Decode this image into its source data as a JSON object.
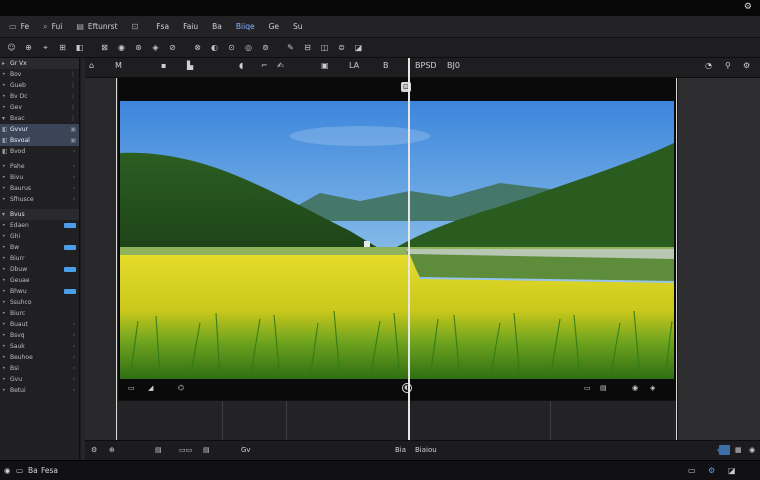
{
  "window": {
    "title_icon": "settings-icon",
    "title_glyph": "⚙"
  },
  "menubar": {
    "items": [
      {
        "icon": "▭",
        "label": "Fe"
      },
      {
        "icon": "⌕",
        "label": "Fui"
      },
      {
        "icon": "▤",
        "label": "Eftunrst"
      },
      {
        "icon": "⊡",
        "label": ""
      },
      {
        "icon": "",
        "label": "Fsa"
      },
      {
        "icon": "",
        "label": "Faiu"
      },
      {
        "icon": "",
        "label": "Ba"
      },
      {
        "icon": "",
        "label": "Biiqe"
      },
      {
        "icon": "",
        "label": "Ge"
      },
      {
        "icon": "",
        "label": "Su"
      }
    ]
  },
  "toolbar": {
    "tools": [
      "☺",
      "⊕",
      "⌖",
      "⊞",
      "◧",
      "⊠",
      "◉",
      "⊛",
      "◈",
      "⊘",
      "⊗",
      "◐",
      "⊙",
      "◎",
      "⊚",
      "✎",
      "⊟",
      "◫",
      "⊜",
      "◪"
    ]
  },
  "left_panel": {
    "rows": [
      {
        "icon": "▸",
        "label": "Gr Vx",
        "ctl": "",
        "kind": "hdr"
      },
      {
        "icon": "•",
        "label": "Bov",
        "ctl": "⋮",
        "kind": ""
      },
      {
        "icon": "•",
        "label": "Gueb",
        "ctl": "⋮",
        "kind": ""
      },
      {
        "icon": "•",
        "label": "Bv Dc",
        "ctl": "⋮",
        "kind": ""
      },
      {
        "icon": "•",
        "label": "Gev",
        "ctl": "⋮",
        "kind": ""
      },
      {
        "icon": "▾",
        "label": "Bxac",
        "ctl": "⋮",
        "kind": ""
      },
      {
        "icon": "◧",
        "label": "Gvvur",
        "ctl": "▣",
        "kind": "sel"
      },
      {
        "icon": "◧",
        "label": "Bsvoal",
        "ctl": "▣",
        "kind": "sel"
      },
      {
        "icon": "◧",
        "label": "Bvod",
        "ctl": "◦",
        "kind": ""
      },
      {
        "icon": "",
        "label": "",
        "ctl": "",
        "kind": "sep"
      },
      {
        "icon": "•",
        "label": "Pahe",
        "ctl": "◦",
        "kind": ""
      },
      {
        "icon": "•",
        "label": "Bivu",
        "ctl": "◦",
        "kind": ""
      },
      {
        "icon": "•",
        "label": "Baurus",
        "ctl": "◦",
        "kind": ""
      },
      {
        "icon": "•",
        "label": "Sfhusce",
        "ctl": "◦",
        "kind": ""
      },
      {
        "icon": "",
        "label": "",
        "ctl": "",
        "kind": "sep"
      },
      {
        "icon": "▾",
        "label": "Bvus",
        "ctl": "",
        "kind": "hdr"
      },
      {
        "icon": "•",
        "label": "Edaen",
        "ctl": "bar",
        "kind": ""
      },
      {
        "icon": "•",
        "label": "Ghi",
        "ctl": "",
        "kind": ""
      },
      {
        "icon": "•",
        "label": "Bw",
        "ctl": "bar",
        "kind": ""
      },
      {
        "icon": "•",
        "label": "Biurr",
        "ctl": "",
        "kind": ""
      },
      {
        "icon": "•",
        "label": "Dbuw",
        "ctl": "bar",
        "kind": ""
      },
      {
        "icon": "•",
        "label": "Geuae",
        "ctl": "",
        "kind": ""
      },
      {
        "icon": "•",
        "label": "Bhwu",
        "ctl": "bar",
        "kind": ""
      },
      {
        "icon": "•",
        "label": "Ssuhco",
        "ctl": "",
        "kind": ""
      },
      {
        "icon": "•",
        "label": "Biurc",
        "ctl": "",
        "kind": ""
      },
      {
        "icon": "•",
        "label": "Buaut",
        "ctl": "◦",
        "kind": ""
      },
      {
        "icon": "•",
        "label": "Bsvq",
        "ctl": "◦",
        "kind": ""
      },
      {
        "icon": "•",
        "label": "Sauk",
        "ctl": "◦",
        "kind": ""
      },
      {
        "icon": "•",
        "label": "Beuhoe",
        "ctl": "◦",
        "kind": ""
      },
      {
        "icon": "•",
        "label": "Bsi",
        "ctl": "◦",
        "kind": ""
      },
      {
        "icon": "•",
        "label": "Gvu",
        "ctl": "◦",
        "kind": ""
      },
      {
        "icon": "•",
        "label": "Betui",
        "ctl": "◦",
        "kind": ""
      }
    ]
  },
  "canvas_header": {
    "items": [
      "⌂",
      "M",
      "▪",
      "▙",
      "◖",
      "⌐",
      "✍",
      "▣",
      "LA",
      "B",
      "BPSD",
      "BJ0",
      "◔",
      "⚲",
      "⚙"
    ]
  },
  "frame": {
    "top_control": "⊡",
    "bar_left": [
      "▭",
      "◢",
      "⌬"
    ],
    "bar_center": "◐",
    "bar_right": [
      "▭",
      "▤",
      "◉",
      "◈"
    ]
  },
  "bottom_toolbar": {
    "items": [
      "⚙",
      "⊕",
      "▤",
      "▭▭",
      "Gv",
      "▤",
      "Bia",
      "◈",
      "Biaiou",
      "▦",
      "◉"
    ]
  },
  "status_bar": {
    "left_label": "Ba",
    "right_label": "Fesa",
    "icons": [
      "▭",
      "⚙",
      "◪"
    ]
  },
  "colors": {
    "accent": "#4fa3f7",
    "panel": "#202023",
    "workspace": "#29292c",
    "sky_top": "#4a8fe0",
    "sky_bottom": "#bcdaf0",
    "field_yellow": "#d8d21a",
    "grass_green": "#3f8a1c"
  }
}
